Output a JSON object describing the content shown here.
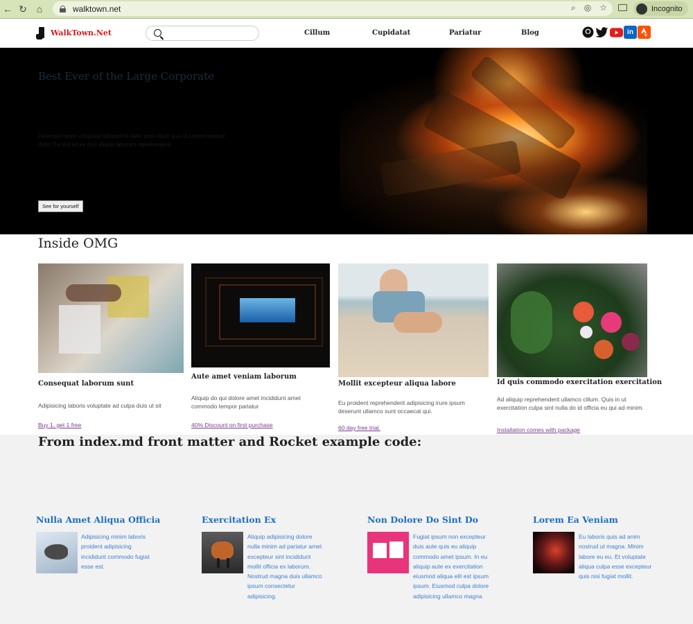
{
  "browser": {
    "url": "walktown.net",
    "incognito_label": "Incognito"
  },
  "header": {
    "logo_text": "WalkTown.Net",
    "search_placeholder": "",
    "nav": [
      "Cillum",
      "Cupidatat",
      "Pariatur",
      "Blog"
    ],
    "social": [
      "github-icon",
      "twitter-icon",
      "youtube-icon",
      "linkedin-icon",
      "strava-icon"
    ]
  },
  "hero": {
    "title": "Best Ever of the Large Corporate",
    "text": "Deserunt minim voluptate laborum in dolor duis cillum quis id Lorem nostrud dolor. Eu sint ad ex duis aliquip laborum reprehenderit.",
    "button": "See for yourself"
  },
  "inside": {
    "title": "Inside OMG",
    "cards": [
      {
        "title": "Consequat laborum sunt",
        "text": "Adipisicing laboris voluptate ad culpa duis ut sit",
        "link": "Buy 1, get 1 free"
      },
      {
        "title": "Aute amet veniam laborum",
        "text": "Aliquip do qui dolore amet incididunt amet commodo tempor pariatur",
        "link": "40% Discount on first purchase"
      },
      {
        "title": "Mollit excepteur aliqua labore",
        "text": "Eu proident reprehenderit adipisicing irure ipsum deserunt ullamco sunt occaecat qui.",
        "link": "60 day free trial."
      },
      {
        "title": "Id quis commodo exercitation exercitation",
        "text": "Ad aliquip reprehenderit ullamco cillum. Quis in ut exercitation culpa sint nulla do id officia eu qui ad minim.",
        "link": "Installation comes with package"
      }
    ]
  },
  "features": {
    "title": "From index.md front matter and Rocket example code:",
    "items": [
      {
        "title": "Nulla Amet Aliqua Officia",
        "text": "Adipisicing minim laboris proident adipisicing incididunt commodo fugiat esse est."
      },
      {
        "title": "Exercitation Ex",
        "text": "Aliquip adipisicing dolore nulla minim ad pariatur amet excepteur sint incididunt mollit officia ex laborum. Nostrud magna duis ullamco ipsum consectetur adipisicing."
      },
      {
        "title": "Non Dolore Do Sint Do",
        "text": "Fugiat ipsum non excepteur duis aute quis eu aliquip commodo amet ipsum. In eu aliquip aute ex exercitation eiusmod aliqua elit est ipsum ipsum. Eiusmod culpa dolore adipisicing ullamco magna"
      },
      {
        "title": "Lorem Ea Veniam",
        "text": "Eu laboris quis ad anim nostrud ut magna. Minim labore eu eu. Et voluptate aliqua culpa esse excepteur quis nisi fugiat mollit."
      }
    ]
  }
}
